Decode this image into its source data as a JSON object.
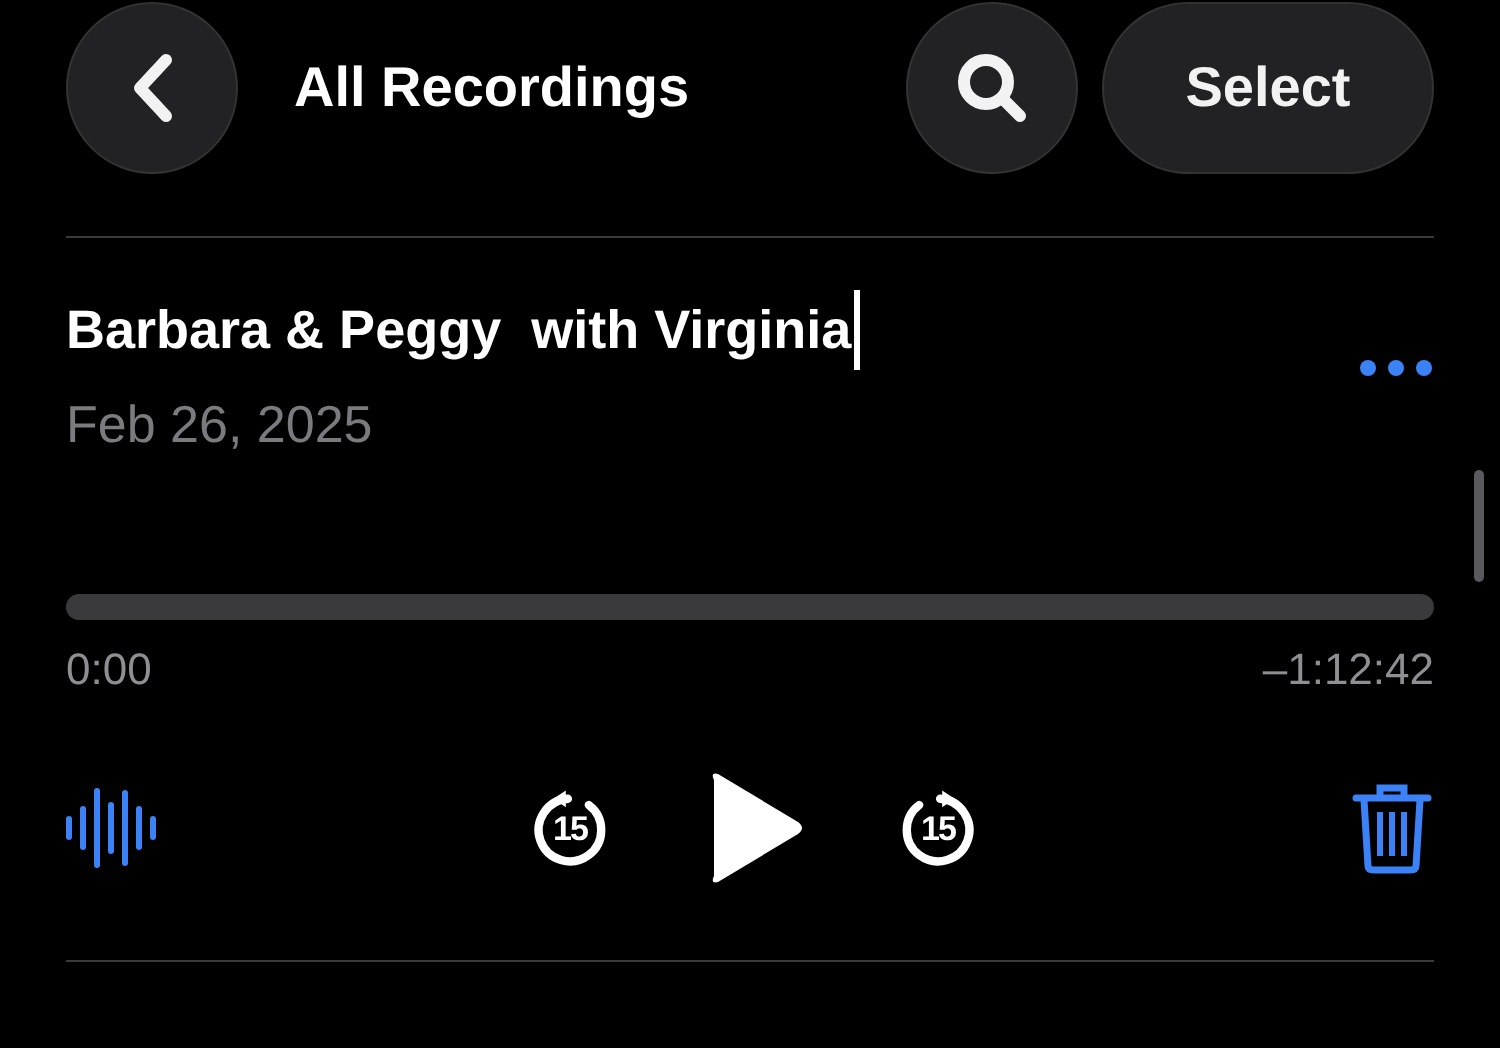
{
  "header": {
    "title": "All Recordings",
    "select_label": "Select"
  },
  "recording": {
    "title": "Barbara & Peggy  with Virginia",
    "editing": true,
    "date": "Feb 26, 2025",
    "elapsed": "0:00",
    "remaining": "–1:12:42"
  },
  "controls": [
    {
      "kind": "waveform"
    },
    {
      "kind": "skip-back",
      "label": "15"
    },
    {
      "kind": "play"
    },
    {
      "kind": "skip-forward",
      "label": "15"
    },
    {
      "kind": "trash"
    }
  ]
}
